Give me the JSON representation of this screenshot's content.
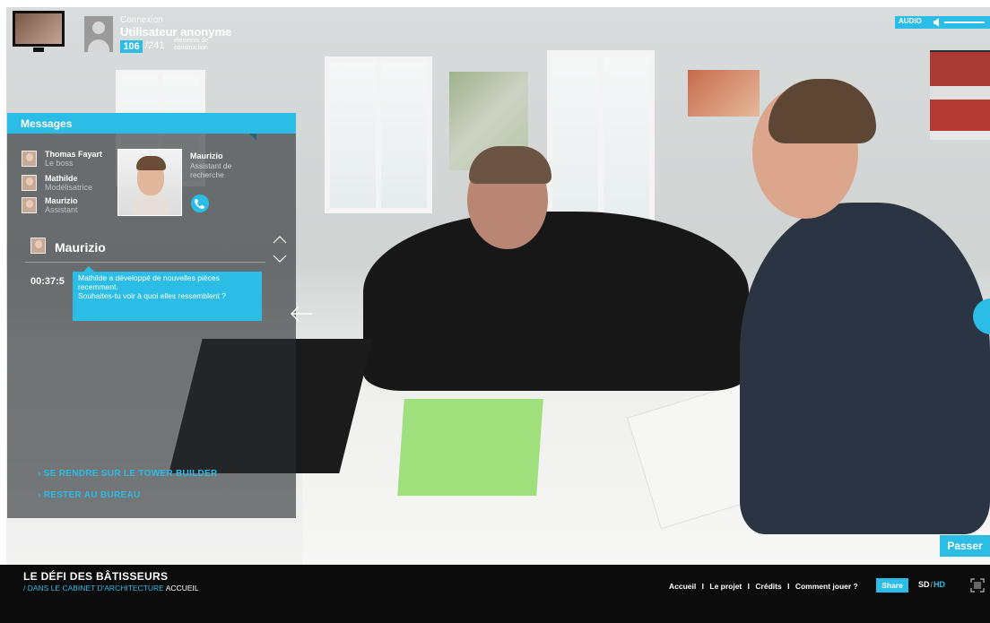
{
  "header": {
    "login_label": "Connexion",
    "user_name": "Utilisateur anonyme",
    "count_current": "106",
    "count_total": "/241",
    "count_unit": "éléments de construction"
  },
  "audio": {
    "label": "AUDIO"
  },
  "messages": {
    "title": "Messages",
    "contacts": [
      {
        "name": "Thomas Fayart",
        "role": "Le boss"
      },
      {
        "name": "Mathilde",
        "role": "Modélisatrice"
      },
      {
        "name": "Maurizio",
        "role": "Assistant"
      }
    ],
    "featured": {
      "name": "Maurizio",
      "role": "Assistant de recherche"
    },
    "chat": {
      "name": "Maurizio",
      "time": "00:37:5",
      "line1": "Mathilde a développé de nouvelles pièces recemment.",
      "line2": "Souhaites-tu voir à quoi elles ressemblent ?"
    }
  },
  "choices": {
    "tower": "SE RENDRE SUR LE TOWER BUILDER",
    "office": "RESTER AU BUREAU"
  },
  "skip_label": "Passer",
  "footer": {
    "site_title": "LE DÉFI DES BÂTISSEURS",
    "crumb_1": "/ DANS LE CABINET D'ARCHITECTURE",
    "crumb_2": "ACCUEIL",
    "nav": [
      "Accueil",
      "Le projet",
      "Crédits",
      "Comment jouer ?"
    ],
    "nav_separator": "I",
    "share_label": "Share",
    "quality_sd": "SD",
    "quality_sep": "/",
    "quality_hd": "HD"
  },
  "colors": {
    "accent": "#2bbde6",
    "footer_bg": "#0b0b0b"
  },
  "icons": [
    "monitor-icon",
    "user-icon",
    "speaker-icon",
    "phone-icon",
    "chevron-up-icon",
    "chevron-down-icon",
    "arrow-left-icon",
    "fullscreen-icon"
  ]
}
